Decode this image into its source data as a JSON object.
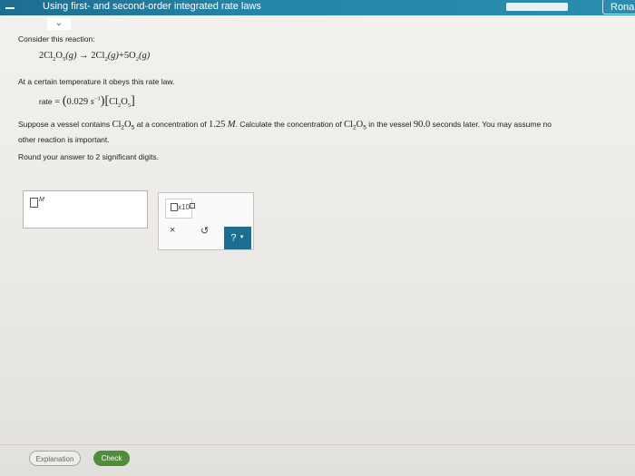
{
  "header": {
    "topic_title": "Using first- and second-order integrated rate laws",
    "user_name": "Ronal",
    "progress_fraction": 1.0
  },
  "question": {
    "intro": "Consider this reaction:",
    "reaction": {
      "reactant": "2Cl",
      "reactant_sub1": "2",
      "reactant_o": "O",
      "reactant_sub2": "5",
      "reactant_state": "(g)",
      "arrow": "→",
      "product1": "2Cl",
      "product1_sub": "2",
      "product1_state": "(g)",
      "plus": "+",
      "product2": "5O",
      "product2_sub": "2",
      "product2_state": "(g)"
    },
    "rate_law_intro": "At a certain temperature it obeys this rate law.",
    "rate_law": {
      "lhs": "rate",
      "eq": "=",
      "k_value": "0.029",
      "k_unit": "s",
      "k_exp": "−1",
      "conc_species": "Cl",
      "conc_sub1": "2",
      "conc_o": "O",
      "conc_sub2": "5"
    },
    "problem_part1": "Suppose a vessel contains",
    "problem_species": "Cl",
    "problem_sub1": "2",
    "problem_o": "O",
    "problem_sub2": "5",
    "problem_part2": "at a concentration of",
    "concentration": "1.25",
    "conc_unit": "M",
    "problem_part3": ". Calculate the concentration of",
    "problem_part4": "in the vessel",
    "time": "90.0",
    "problem_part5": "seconds later. You may assume no",
    "problem_line2": "other reaction is important.",
    "rounding": "Round your answer to 2 significant digits."
  },
  "answer": {
    "unit": "M",
    "sci_notation_label": "x10"
  },
  "tools": {
    "clear": "×",
    "undo": "↺",
    "help": "?"
  },
  "footer": {
    "explanation_label": "Explanation",
    "check_label": "Check"
  }
}
